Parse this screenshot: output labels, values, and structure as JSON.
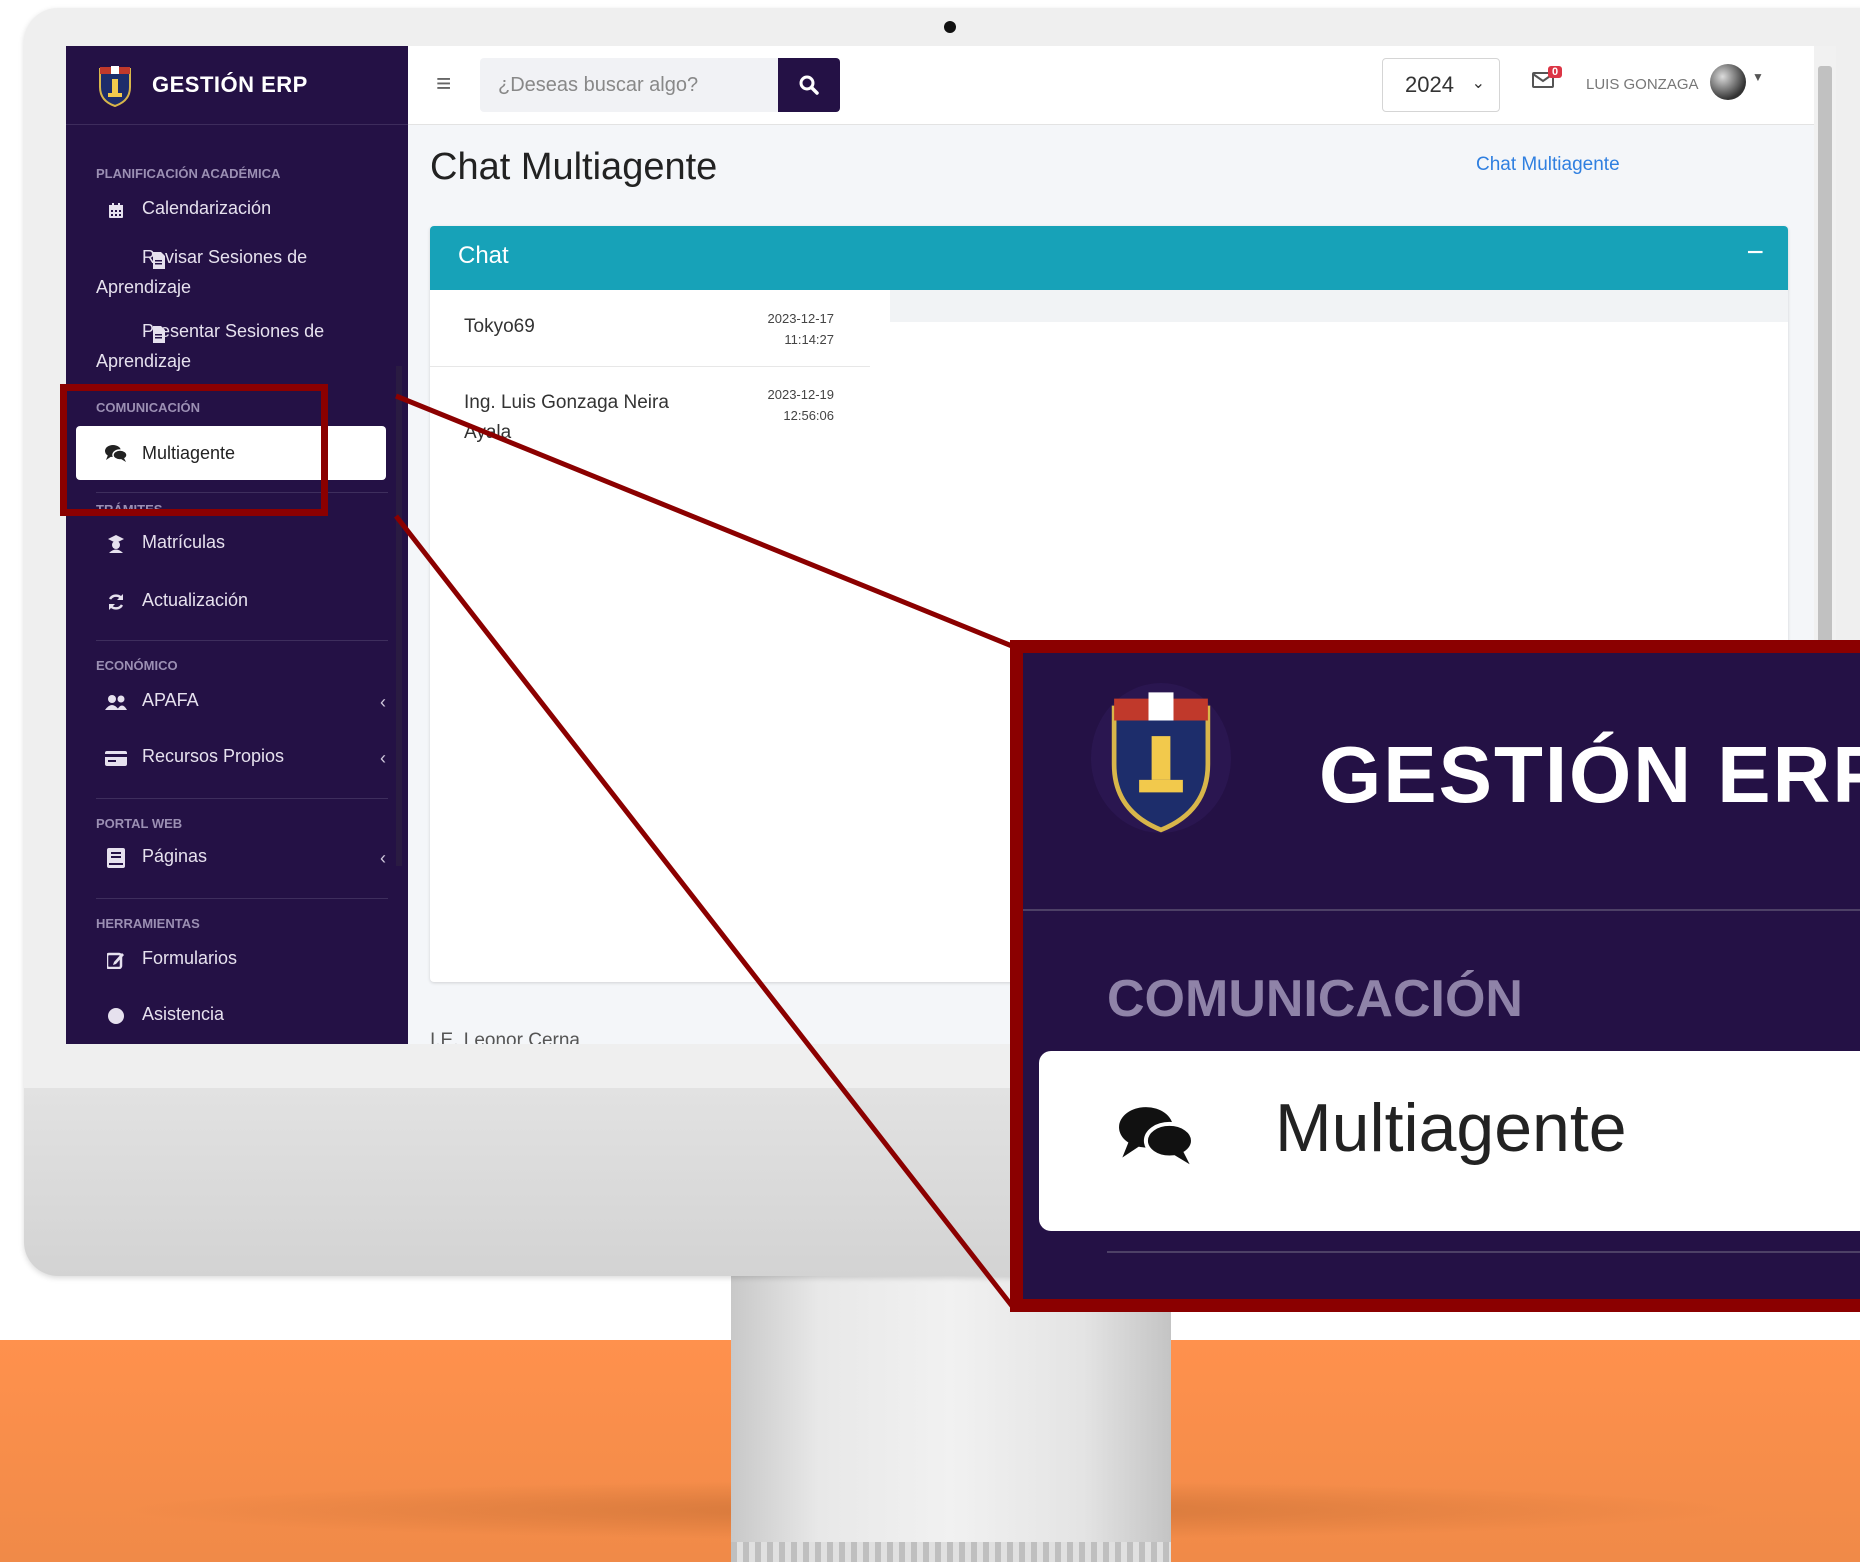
{
  "brand": {
    "name": "GESTIÓN ERP"
  },
  "sidebar": {
    "sections": [
      {
        "title": "PLANIFICACIÓN ACADÉMICA"
      },
      {
        "title": "COMUNICACIÓN"
      },
      {
        "title": "TRÁMITES"
      },
      {
        "title": "ECONÓMICO"
      },
      {
        "title": "PORTAL WEB"
      },
      {
        "title": "HERRAMIENTAS"
      }
    ],
    "items": [
      {
        "label": "Calendarización",
        "icon": "calendar-icon"
      },
      {
        "label": "Revisar Sesiones de Aprendizaje",
        "icon": "file-icon"
      },
      {
        "label": "Presentar Sesiones de Aprendizaje",
        "icon": "file-icon"
      },
      {
        "label": "Multiagente",
        "icon": "comments-icon",
        "active": true
      },
      {
        "label": "Matrículas",
        "icon": "graduate-icon"
      },
      {
        "label": "Actualización",
        "icon": "sync-icon"
      },
      {
        "label": "APAFA",
        "icon": "users-icon"
      },
      {
        "label": "Recursos Propios",
        "icon": "money-icon"
      },
      {
        "label": "Páginas",
        "icon": "book-icon"
      },
      {
        "label": "Formularios",
        "icon": "edit-icon"
      },
      {
        "label": "Asistencia",
        "icon": "clock-icon"
      }
    ]
  },
  "topbar": {
    "search_placeholder": "¿Deseas buscar algo?",
    "year": "2024",
    "mail_count": "0",
    "user_name": "LUIS GONZAGA"
  },
  "page": {
    "title": "Chat Multiagente",
    "breadcrumb": "Chat Multiagente"
  },
  "chat": {
    "header": "Chat",
    "conversations": [
      {
        "name": "Tokyo69",
        "date": "2023-12-17",
        "time": "11:14:27"
      },
      {
        "name": "Ing. Luis Gonzaga Neira Ayala",
        "date": "2023-12-19",
        "time": "12:56:06"
      }
    ]
  },
  "footer_partial": {
    "name": "I.E. Leonor Cerna"
  },
  "zoom": {
    "brand": "GESTIÓN ERP",
    "section": "COMUNICACIÓN",
    "item": "Multiagente"
  },
  "colors": {
    "sidebar": "#241145",
    "card_header": "#17a2b8",
    "highlight": "#8b0000",
    "floor": "#ff914d"
  }
}
